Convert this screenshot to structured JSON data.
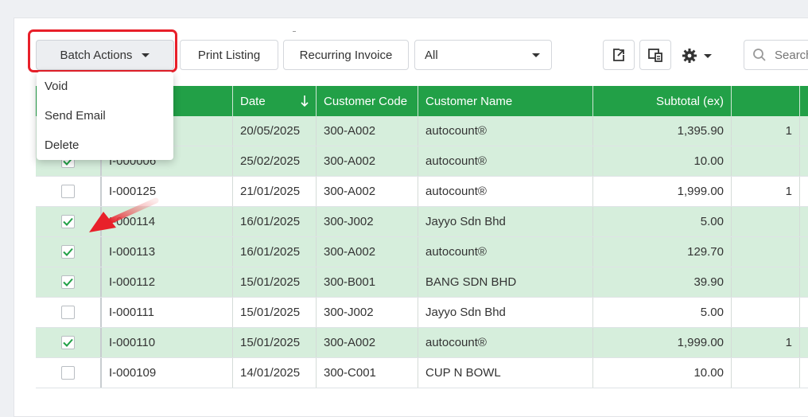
{
  "toolbar": {
    "batch_actions_label": "Batch Actions",
    "print_listing_label": "Print Listing",
    "recurring_invoice_label": "Recurring Invoice",
    "filter_value": "All",
    "search_placeholder": "Search"
  },
  "batch_menu": {
    "items": [
      {
        "label": "Void"
      },
      {
        "label": "Send Email"
      },
      {
        "label": "Delete"
      }
    ]
  },
  "table": {
    "columns": {
      "date": "Date",
      "customer_code": "Customer Code",
      "customer_name": "Customer Name",
      "subtotal": "Subtotal (ex)"
    },
    "rows": [
      {
        "checked": true,
        "doc_no": "",
        "date": "20/05/2025",
        "code": "300-A002",
        "name": "autocount®",
        "subtotal": "1,395.90",
        "next": "1"
      },
      {
        "checked": true,
        "doc_no": "I-000006",
        "date": "25/02/2025",
        "code": "300-A002",
        "name": "autocount®",
        "subtotal": "10.00",
        "next": ""
      },
      {
        "checked": false,
        "doc_no": "I-000125",
        "date": "21/01/2025",
        "code": "300-A002",
        "name": "autocount®",
        "subtotal": "1,999.00",
        "next": "1"
      },
      {
        "checked": true,
        "doc_no": "I-000114",
        "date": "16/01/2025",
        "code": "300-J002",
        "name": "Jayyo Sdn Bhd",
        "subtotal": "5.00",
        "next": ""
      },
      {
        "checked": true,
        "doc_no": "I-000113",
        "date": "16/01/2025",
        "code": "300-A002",
        "name": "autocount®",
        "subtotal": "129.70",
        "next": ""
      },
      {
        "checked": true,
        "doc_no": "I-000112",
        "date": "15/01/2025",
        "code": "300-B001",
        "name": "BANG SDN BHD",
        "subtotal": "39.90",
        "next": ""
      },
      {
        "checked": false,
        "doc_no": "I-000111",
        "date": "15/01/2025",
        "code": "300-J002",
        "name": "Jayyo Sdn Bhd",
        "subtotal": "5.00",
        "next": ""
      },
      {
        "checked": true,
        "doc_no": "I-000110",
        "date": "15/01/2025",
        "code": "300-A002",
        "name": "autocount®",
        "subtotal": "1,999.00",
        "next": "1"
      },
      {
        "checked": false,
        "doc_no": "I-000109",
        "date": "14/01/2025",
        "code": "300-C001",
        "name": "CUP N BOWL",
        "subtotal": "10.00",
        "next": ""
      }
    ]
  },
  "colors": {
    "header_green": "#22a047",
    "selected_row": "#d6eedc",
    "highlight_red": "#e8202a"
  },
  "icons": [
    "caret-down-icon",
    "export-icon",
    "view-icon",
    "gear-icon",
    "search-icon",
    "sort-down-icon",
    "check-icon",
    "arrow-icon"
  ]
}
